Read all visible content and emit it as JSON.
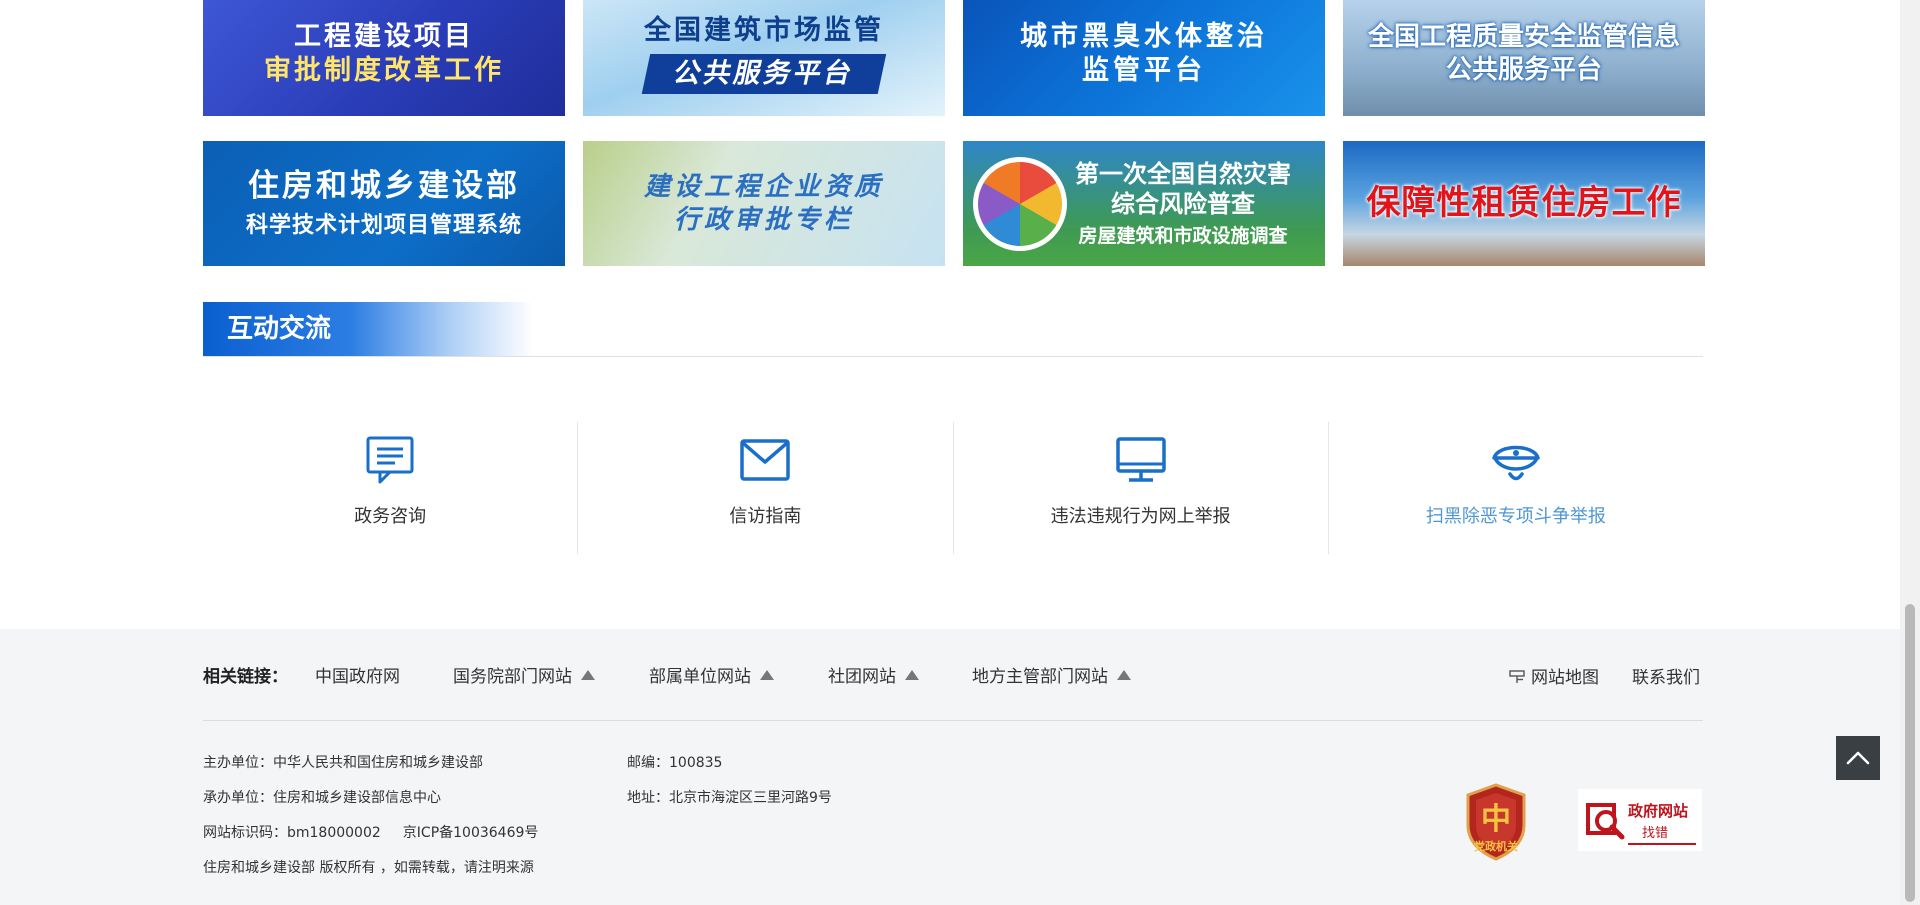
{
  "banners": [
    {
      "l1": "工程建设项目",
      "l2": "审批制度改革工作"
    },
    {
      "l1": "全国建筑市场监管",
      "l2": "公共服务平台"
    },
    {
      "l1": "城市黑臭水体整治",
      "l2": "监管平台"
    },
    {
      "l1": "全国工程质量安全监管信息",
      "l2": "公共服务平台"
    },
    {
      "l1": "住房和城乡建设部",
      "l2": "科学技术计划项目管理系统"
    },
    {
      "l1": "建设工程企业资质",
      "l2": "行政审批专栏"
    },
    {
      "l1": "第一次全国自然灾害",
      "l2": "综合风险普查",
      "l3": "房屋建筑和市政设施调查"
    },
    {
      "l1": "保障性租赁住房工作"
    }
  ],
  "section": {
    "title": "互动交流"
  },
  "interact": [
    {
      "label": "政务咨询",
      "icon": "chat-icon"
    },
    {
      "label": "信访指南",
      "icon": "mail-icon"
    },
    {
      "label": "违法违规行为网上举报",
      "icon": "monitor-icon"
    },
    {
      "label": "扫黑除恶专项斗争举报",
      "icon": "police-cap-icon"
    }
  ],
  "footer": {
    "links_label": "相关链接：",
    "links": [
      "中国政府网",
      "国务院部门网站",
      "部属单位网站",
      "社团网站",
      "地方主管部门网站"
    ],
    "sitemap": "网站地图",
    "contact": "联系我们",
    "host": "主办单位：中华人民共和国住房和城乡建设部",
    "organizer": "承办单位：住房和城乡建设部信息中心",
    "site_code": "网站标识码：bm18000002",
    "icp": "京ICP备10036469号",
    "copyright": "住房和城乡建设部 版权所有 ，如需转载，请注明来源",
    "postcode": "邮编：100835",
    "address": "地址：北京市海淀区三里河路9号",
    "badge1_text": "党政机关",
    "badge2_l1": "政府网站",
    "badge2_l2": "找错"
  },
  "colors": {
    "accent": "#0a5fd0",
    "footer_bg": "#f4f5f6",
    "highlight": "#4e97d4",
    "icon": "#1a6fc9"
  }
}
